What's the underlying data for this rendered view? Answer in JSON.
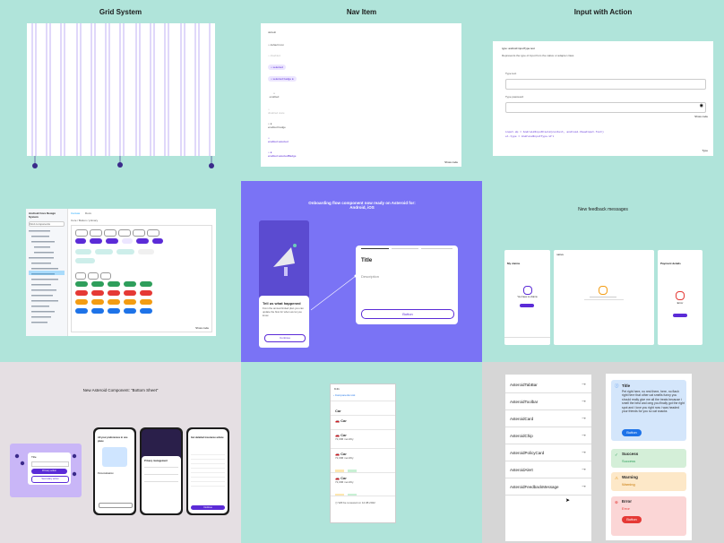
{
  "grid_system": {
    "title": "Grid System"
  },
  "nav_item": {
    "title": "Nav Item",
    "header": "default",
    "items": [
      "default icon",
      "disabled",
      "selected",
      "selected badge",
      "enabled",
      "disabled state",
      "enabled badge",
      "enabled selected",
      "enabled selectedBadge"
    ],
    "footer": "Show code"
  },
  "input_action": {
    "title": "Input with Action",
    "heading": "type: android:inputType.text",
    "description": "Represents the type of input from the native or adapter class",
    "label_text": "Type text",
    "label_password": "Type password",
    "show_code": "Show code",
    "code_line1": "input.dp = AndroidInputField(context, android.ViewInput.Text)",
    "code_line2": "el.type = AndroidInputType.Url",
    "footer": "Type"
  },
  "storybook": {
    "sidebar_title": "Android Core Design System",
    "search": "Find components",
    "canvas_tab": "Canvas",
    "docs_tab": "Docs",
    "breadcrumb": "Core / Button / primary",
    "footer": "Show code"
  },
  "onboarding": {
    "title": "Onboarding flow component now ready on Asteroid for: Android, iOS",
    "phone_title": "Tell us what happened",
    "phone_text": "From the annual limited plan you can update the flow for when we let you know",
    "phone_button": "Continue",
    "card_title": "Title",
    "card_desc": "Description",
    "card_button": "Button"
  },
  "feedback": {
    "title": "New feedback messages",
    "screen1_header": "My claims",
    "screen1_title": "You have no claims",
    "screen2_header": "native",
    "screen3_header": "Payment details",
    "screen3_title": "Error"
  },
  "bottom_sheet": {
    "title": "New Asteroid Component: “Bottom Sheet”",
    "sheet_title": "Title",
    "primary": "Primary action",
    "secondary": "Secondary action",
    "phone1_title": "All your preferences in one place",
    "phone1_sub": "Personalisation",
    "phone2_title": "Privacy management",
    "phone3_title": "Get detailed insurance advice",
    "phone3_button": "Continue"
  },
  "components_list": {
    "time": "9:41",
    "back": "Components List",
    "section": "Car",
    "items": [
      {
        "name": "Car",
        "price": ""
      },
      {
        "name": "Car",
        "price": "72,09€ monthly"
      },
      {
        "name": "Car",
        "price": "72,09€ monthly"
      },
      {
        "name": "Car",
        "price": "72,09€ monthly"
      }
    ],
    "footer_note": "Will be renewed on 12.08.2022"
  },
  "asteroid_list": {
    "items": [
      "AsteroidTabBar",
      "AsteroidToolbar",
      "AsteroidCard",
      "AsteroidChip",
      "AsteroidPolicyCard",
      "AsteroidAlert",
      "AsteroidFeedbackMessage"
    ],
    "arrow": "→"
  },
  "messages": {
    "info_title": "Title",
    "info_text": "Pet right here, no rest there, here, no flash right here that other cat smells funny you should really give me all the treats because i smell the best and omg you finally got the right spot and i love you right now i was headed your friends for you so cat snacks",
    "info_button": "Button",
    "success_title": "Success",
    "success_text": "Success",
    "warning_title": "Warning",
    "warning_text": "Warning",
    "error_title": "Error",
    "error_text": "Error",
    "error_button": "Button"
  },
  "colors": {
    "mint": "#b0e4da",
    "purple": "#5b2bd7",
    "violet": "#7a73f5",
    "blue": "#1e73e8",
    "red": "#e53935"
  }
}
